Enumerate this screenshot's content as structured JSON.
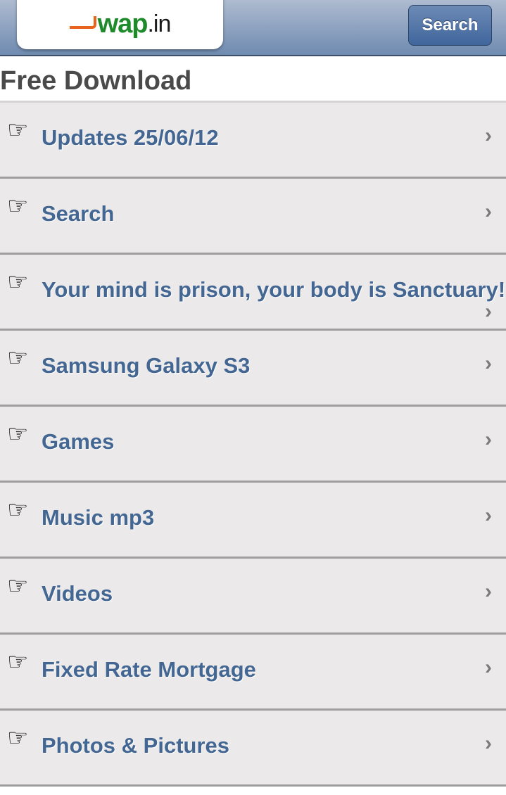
{
  "header": {
    "logo": {
      "mark": "",
      "wap": "wap",
      "suffix": ".in"
    },
    "search_button": "Search"
  },
  "page_title": "Free Download",
  "icons": {
    "item_icon": "☞",
    "chevron": "›"
  },
  "items": [
    {
      "label": "Updates 25/06/12"
    },
    {
      "label": "Search"
    },
    {
      "label": "Your mind is prison, your body is Sanctuary!"
    },
    {
      "label": "Samsung Galaxy S3"
    },
    {
      "label": "Games"
    },
    {
      "label": "Music mp3"
    },
    {
      "label": "Videos"
    },
    {
      "label": "Fixed Rate Mortgage"
    },
    {
      "label": "Photos & Pictures"
    }
  ]
}
